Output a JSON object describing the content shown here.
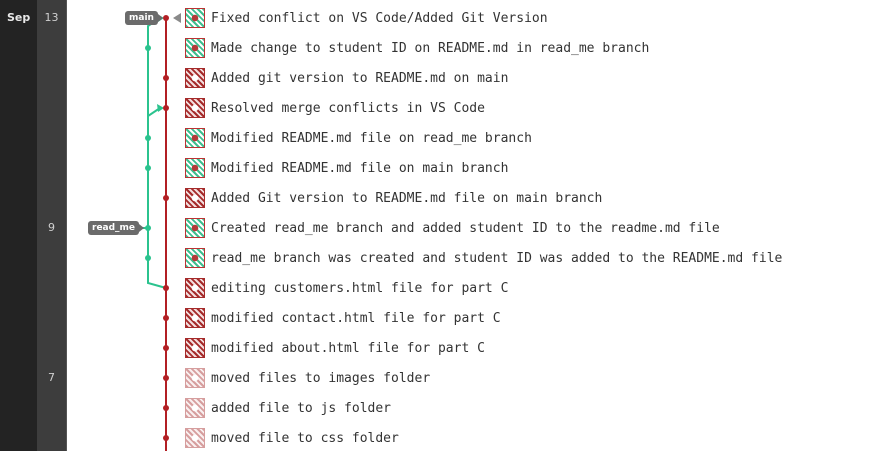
{
  "timeline": {
    "month": "Sep",
    "days": [
      {
        "label": "13",
        "row": 0
      },
      {
        "label": "9",
        "row": 7
      },
      {
        "label": "7",
        "row": 12
      }
    ]
  },
  "refs": {
    "main": "main",
    "read_me": "read_me"
  },
  "colors": {
    "main_branch": "#b21f24",
    "read_me_branch": "#2bc38e"
  },
  "commits": [
    {
      "message": "Fixed conflict on VS Code/Added Git Version",
      "avatar": "green"
    },
    {
      "message": "Made change to student ID on README.md in read_me branch",
      "avatar": "green"
    },
    {
      "message": "Added git version to README.md on main",
      "avatar": "red"
    },
    {
      "message": "Resolved merge conflicts in VS Code",
      "avatar": "red"
    },
    {
      "message": "Modified README.md file on read_me branch",
      "avatar": "green"
    },
    {
      "message": "Modified README.md file on main branch",
      "avatar": "green"
    },
    {
      "message": "Added Git version to README.md file on main branch",
      "avatar": "red"
    },
    {
      "message": "Created read_me branch and added student ID to the readme.md file",
      "avatar": "green"
    },
    {
      "message": "read_me branch was created and student ID was added to the README.md file",
      "avatar": "green"
    },
    {
      "message": "editing customers.html file for part C",
      "avatar": "red"
    },
    {
      "message": "modified contact.html file for part C",
      "avatar": "red"
    },
    {
      "message": "modified about.html file for part C",
      "avatar": "red"
    },
    {
      "message": "moved files to images folder",
      "avatar": "red-faded"
    },
    {
      "message": "added file to js folder",
      "avatar": "red-faded"
    },
    {
      "message": "moved file to css folder",
      "avatar": "red-faded"
    }
  ]
}
